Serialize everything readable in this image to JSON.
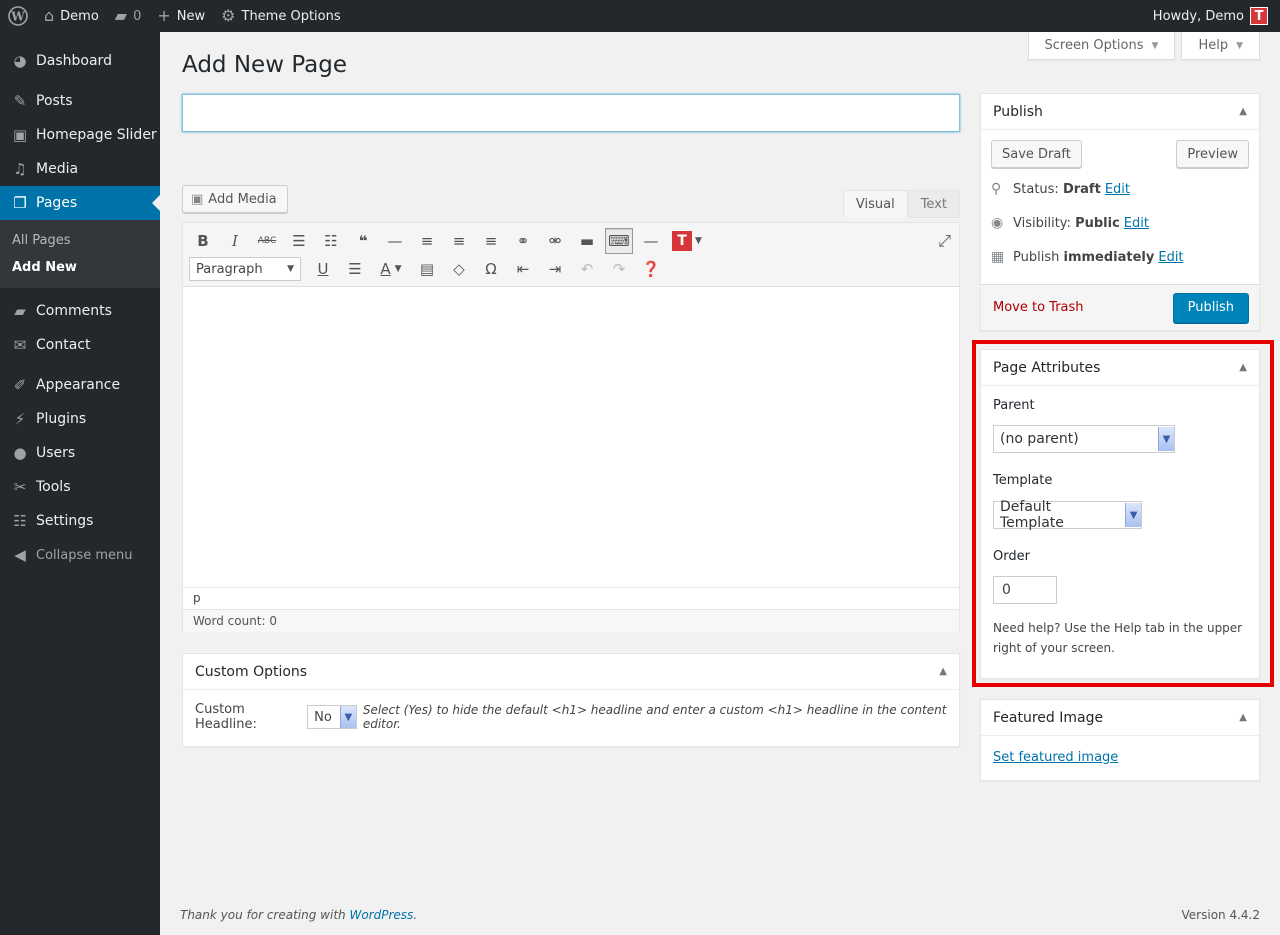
{
  "adminbar": {
    "site_name": "Demo",
    "comments_count": "0",
    "new_label": "New",
    "theme_options_label": "Theme Options",
    "howdy": "Howdy, Demo",
    "avatar_letter": "T"
  },
  "sidebar": {
    "items": [
      {
        "label": "Dashboard",
        "icon": "dashboard-icon"
      },
      {
        "label": "Posts",
        "icon": "pin-icon"
      },
      {
        "label": "Homepage Slider",
        "icon": "slides-icon"
      },
      {
        "label": "Media",
        "icon": "media-icon"
      },
      {
        "label": "Pages",
        "icon": "pages-icon"
      },
      {
        "label": "Comments",
        "icon": "comment-icon"
      },
      {
        "label": "Contact",
        "icon": "mail-icon"
      },
      {
        "label": "Appearance",
        "icon": "brush-icon"
      },
      {
        "label": "Plugins",
        "icon": "plugin-icon"
      },
      {
        "label": "Users",
        "icon": "user-icon"
      },
      {
        "label": "Tools",
        "icon": "wrench-icon"
      },
      {
        "label": "Settings",
        "icon": "settings-icon"
      }
    ],
    "submenu": [
      "All Pages",
      "Add New"
    ],
    "collapse": "Collapse menu"
  },
  "screen_meta": {
    "screen_options": "Screen Options",
    "help": "Help"
  },
  "page_title": "Add New Page",
  "editor": {
    "add_media": "Add Media",
    "tab_visual": "Visual",
    "tab_text": "Text",
    "format_select": "Paragraph",
    "path": "p",
    "word_count": "Word count: 0"
  },
  "custom_options": {
    "title": "Custom Options",
    "label": "Custom Headline:",
    "value": "No",
    "description": "Select (Yes) to hide the default <h1> headline and enter a custom <h1> headline in the content editor."
  },
  "publish": {
    "title": "Publish",
    "save_draft": "Save Draft",
    "preview": "Preview",
    "status_label": "Status:",
    "status_value": "Draft",
    "visibility_label": "Visibility:",
    "visibility_value": "Public",
    "publish_label": "Publish",
    "publish_value": "immediately",
    "edit": "Edit",
    "trash": "Move to Trash",
    "publish_button": "Publish"
  },
  "page_attributes": {
    "title": "Page Attributes",
    "parent_label": "Parent",
    "parent_value": "(no parent)",
    "template_label": "Template",
    "template_value": "Default Template",
    "order_label": "Order",
    "order_value": "0",
    "help": "Need help? Use the Help tab in the upper right of your screen."
  },
  "featured_image": {
    "title": "Featured Image",
    "link": "Set featured image"
  },
  "footer": {
    "thanks_prefix": "Thank you for creating with ",
    "wordpress": "WordPress",
    "thanks_suffix": ".",
    "version": "Version 4.4.2"
  },
  "colors": {
    "accent": "#0073aa",
    "highlight": "#e60000",
    "adminbar": "#23282d"
  }
}
